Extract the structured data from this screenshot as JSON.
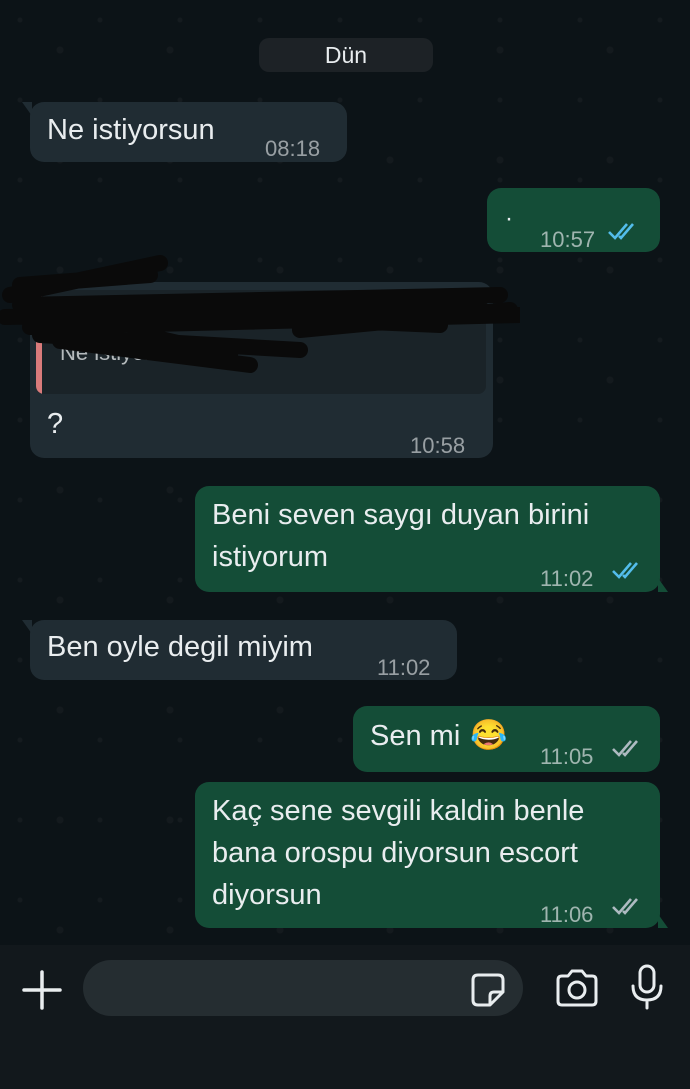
{
  "date_separator": "Dün",
  "messages": [
    {
      "dir": "in",
      "text": "Ne istiyorsun",
      "time": "08:18"
    },
    {
      "dir": "out",
      "text": "·",
      "time": "10:57",
      "status": "read"
    },
    {
      "dir": "in",
      "quoted": "Ne istiyorsun",
      "text": "?",
      "time": "10:58"
    },
    {
      "dir": "out",
      "lines": [
        "Beni seven saygı duyan birini",
        "istiyorum"
      ],
      "time": "11:02",
      "status": "read"
    },
    {
      "dir": "in",
      "text": "Ben oyle degil miyim",
      "time": "11:02"
    },
    {
      "dir": "out",
      "text": "Sen mi",
      "emoji": "😂",
      "time": "11:05",
      "status": "delivered"
    },
    {
      "dir": "out",
      "lines": [
        "Kaç sene sevgili kaldin benle",
        "bana orospu diyorsun escort",
        "diyorsun"
      ],
      "time": "11:06",
      "status": "delivered"
    }
  ],
  "colors": {
    "incoming_bubble": "#202c33",
    "outgoing_bubble": "#144d37",
    "read_ticks": "#53bdeb",
    "delivered_ticks": "#aebac1"
  },
  "composer": {
    "icons": [
      "plus-icon",
      "sticker-icon",
      "camera-icon",
      "mic-icon"
    ]
  }
}
